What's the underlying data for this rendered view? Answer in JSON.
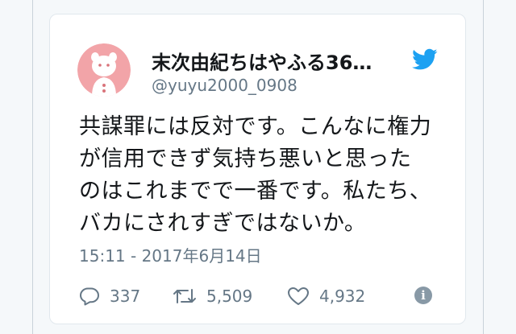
{
  "tweet": {
    "display_name": "末次由紀ちはやふる36…",
    "handle": "@yuyu2000_0908",
    "text_lines": [
      "共謀罪には反対です。こんなに権力",
      "が信用できず気持ち悪いと思った",
      "のはこれまでで一番です。私たち、",
      "バカにされすぎではないか。"
    ],
    "timestamp": "15:11 - 2017年6月14日",
    "replies": "337",
    "retweets": "5,509",
    "likes": "4,932"
  },
  "icons": {
    "reply": "reply-icon",
    "retweet": "retweet-icon",
    "like": "heart-icon",
    "info": "info-icon",
    "brand": "twitter-bird-icon"
  },
  "colors": {
    "brand": "#1da1f2",
    "avatar_bg": "#f2a4a8",
    "muted": "#657786",
    "text": "#14171a"
  }
}
